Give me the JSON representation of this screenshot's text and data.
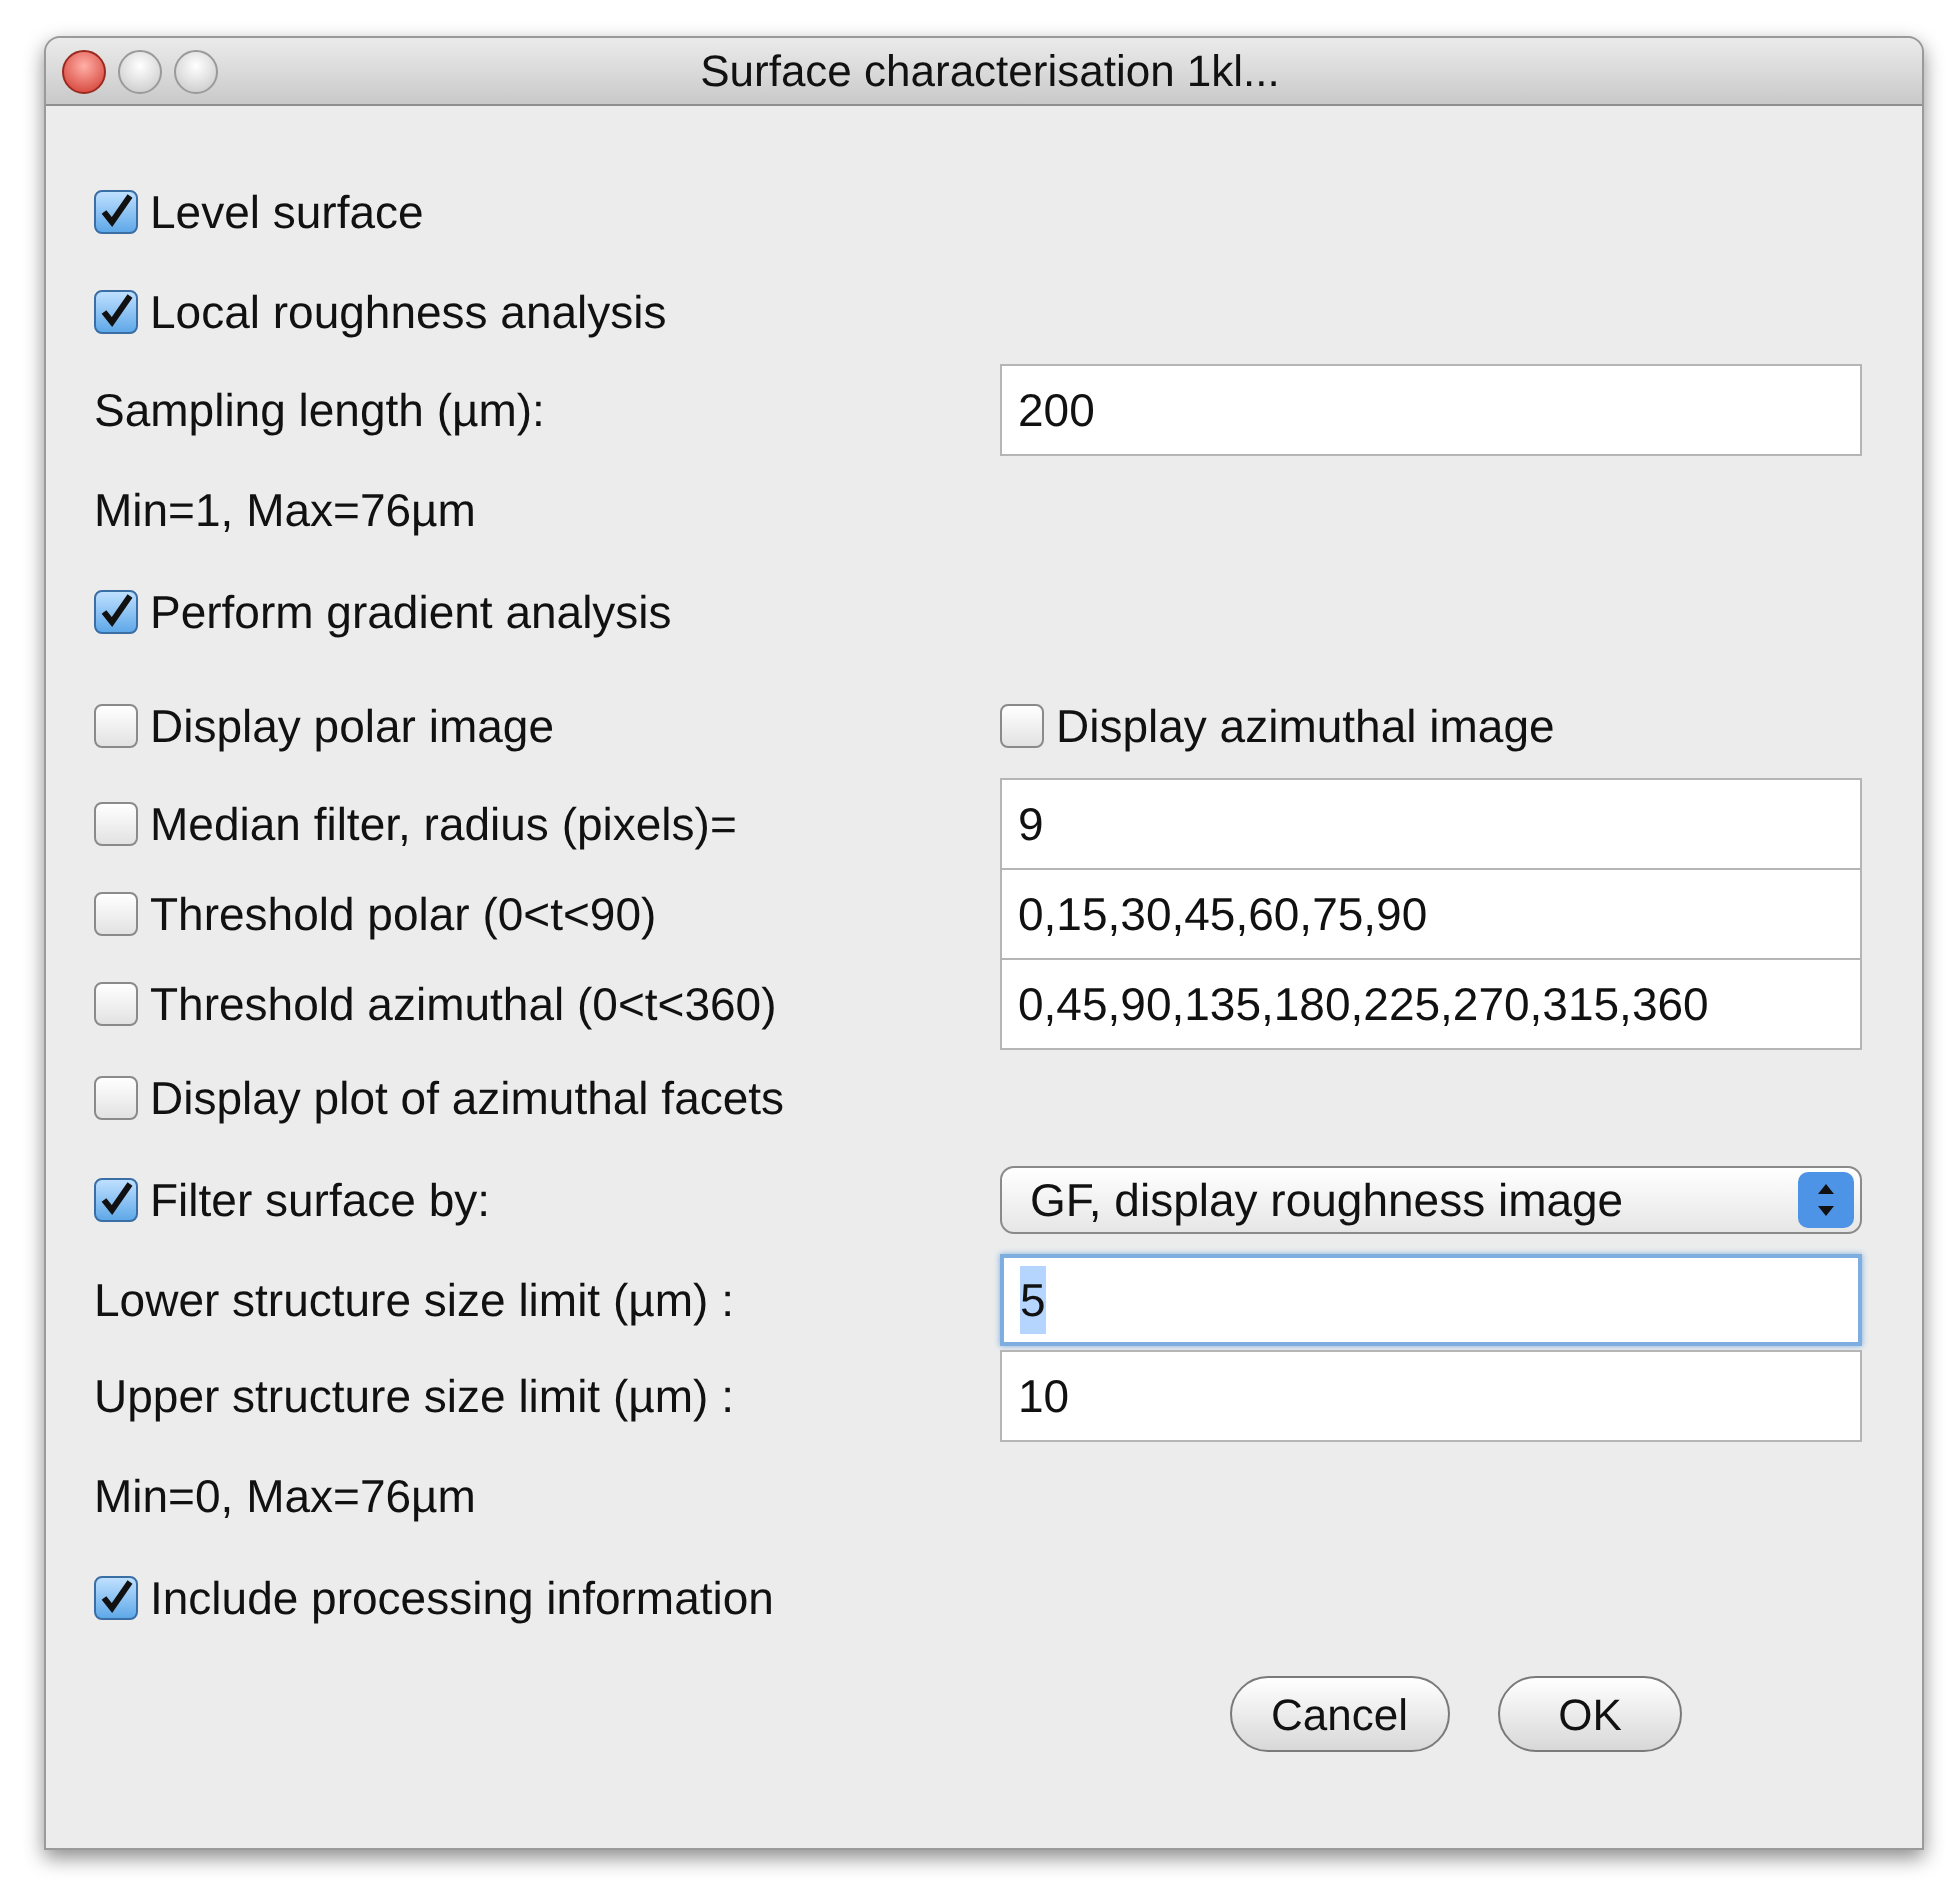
{
  "window": {
    "title": "Surface characterisation 1kl..."
  },
  "rows": [
    {
      "kind": "check",
      "label": "Level surface",
      "checked": true
    },
    {
      "kind": "check",
      "label": "Local roughness analysis",
      "checked": true
    },
    {
      "kind": "field",
      "label": "Sampling length (µm):",
      "value": "200",
      "focused": false
    },
    {
      "kind": "text",
      "label": "Min=1, Max=76µm"
    },
    {
      "kind": "check",
      "label": "Perform gradient analysis",
      "checked": true
    },
    {
      "kind": "check_pair",
      "items": [
        {
          "label": "Display polar image",
          "checked": false
        },
        {
          "label": "Display azimuthal image",
          "checked": false
        }
      ]
    },
    {
      "kind": "check_field",
      "label": "Median filter, radius (pixels)=",
      "checked": false,
      "value": "9"
    },
    {
      "kind": "check_field",
      "label": "Threshold polar (0<t<90)",
      "checked": false,
      "value": "0,15,30,45,60,75,90"
    },
    {
      "kind": "check_field",
      "label": "Threshold azimuthal (0<t<360)",
      "checked": false,
      "value": "0,45,90,135,180,225,270,315,360"
    },
    {
      "kind": "check",
      "label": "Display plot of azimuthal facets",
      "checked": false
    },
    {
      "kind": "check_select",
      "label": "Filter surface by:",
      "checked": true,
      "value": "GF, display roughness image"
    },
    {
      "kind": "field",
      "label": "Lower structure size limit (µm) :",
      "value": "5",
      "focused": true
    },
    {
      "kind": "field",
      "label": "Upper structure size limit (µm) :",
      "value": "10",
      "focused": false
    },
    {
      "kind": "text",
      "label": "Min=0, Max=76µm"
    },
    {
      "kind": "check",
      "label": "Include processing information",
      "checked": true
    }
  ],
  "buttons": [
    {
      "label": "Cancel"
    },
    {
      "label": "OK"
    }
  ]
}
